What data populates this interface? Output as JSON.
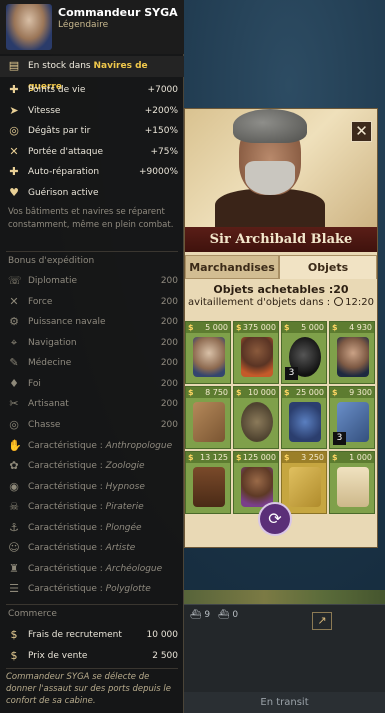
{
  "commander": {
    "name": "Commandeur SYGA",
    "rank": "Légendaire",
    "stock_prefix": "En stock dans ",
    "stock_location": "Navires de guerre"
  },
  "effects": [
    {
      "icon": "plus-icon",
      "label": "Points de vie",
      "value": "+7000"
    },
    {
      "icon": "speed-icon",
      "label": "Vitesse",
      "value": "+200%"
    },
    {
      "icon": "target-icon",
      "label": "Dégâts par tir",
      "value": "+150%"
    },
    {
      "icon": "crossed-swords-icon",
      "label": "Portée d'attaque",
      "value": "+75%"
    },
    {
      "icon": "plus-icon",
      "label": "Auto-réparation",
      "value": "+9000%"
    },
    {
      "icon": "heart-icon",
      "label": "Guérison active",
      "value": ""
    }
  ],
  "effects_description": "Vos bâtiments et navires se réparent constamment, même en plein combat.",
  "expedition": {
    "title": "Bonus d'expédition",
    "items": [
      {
        "icon": "diplomacy-icon",
        "label": "Diplomatie",
        "value": "200"
      },
      {
        "icon": "force-icon",
        "label": "Force",
        "value": "200"
      },
      {
        "icon": "naval-power-icon",
        "label": "Puissance navale",
        "value": "200"
      },
      {
        "icon": "navigation-icon",
        "label": "Navigation",
        "value": "200"
      },
      {
        "icon": "medicine-icon",
        "label": "Médecine",
        "value": "200"
      },
      {
        "icon": "faith-icon",
        "label": "Foi",
        "value": "200"
      },
      {
        "icon": "crafting-icon",
        "label": "Artisanat",
        "value": "200"
      },
      {
        "icon": "hunting-icon",
        "label": "Chasse",
        "value": "200"
      }
    ],
    "traits_prefix": "Caractéristique : ",
    "traits": [
      {
        "icon": "anthropology-icon",
        "label": "Anthropologue"
      },
      {
        "icon": "zoology-icon",
        "label": "Zoologie"
      },
      {
        "icon": "hypnosis-icon",
        "label": "Hypnose"
      },
      {
        "icon": "piracy-icon",
        "label": "Piraterie"
      },
      {
        "icon": "diving-icon",
        "label": "Plongée"
      },
      {
        "icon": "artist-icon",
        "label": "Artiste"
      },
      {
        "icon": "archaeology-icon",
        "label": "Archéologue"
      },
      {
        "icon": "polyglot-icon",
        "label": "Polyglotte"
      }
    ]
  },
  "commerce": {
    "title": "Commerce",
    "items": [
      {
        "icon": "coin-icon",
        "label": "Frais de recrutement",
        "value": "10 000"
      },
      {
        "icon": "coin-icon",
        "label": "Prix de vente",
        "value": "2 500"
      }
    ]
  },
  "flavor_text": "Commandeur SYGA se délecte de donner l'assaut sur des ports depuis le confort de sa cabine.",
  "trader": {
    "name": "Sir Archibald Blake",
    "tabs": [
      "Marchandises",
      "Objets"
    ],
    "active_tab": "Objets",
    "buyable_label": "Objets achetables :20",
    "restock_label": "avitaillement d'objets dans :",
    "restock_time": "12:20",
    "currency_symbol": "$",
    "items": [
      {
        "price": "5 000",
        "art": "officer-portrait-icon",
        "color": "green",
        "qty": ""
      },
      {
        "price": "375 000",
        "art": "woman-portrait-icon",
        "color": "green",
        "qty": ""
      },
      {
        "price": "5 000",
        "art": "cannonball-icon",
        "color": "green",
        "qty": "3"
      },
      {
        "price": "4 930",
        "art": "captain-portrait-icon",
        "color": "green",
        "qty": ""
      },
      {
        "price": "8 750",
        "art": "crate-icon",
        "color": "green",
        "qty": ""
      },
      {
        "price": "10 000",
        "art": "propeller-icon",
        "color": "green",
        "qty": ""
      },
      {
        "price": "25 000",
        "art": "machine-part-icon",
        "color": "green",
        "qty": ""
      },
      {
        "price": "9 300",
        "art": "cargo-box-icon",
        "color": "green",
        "qty": "3"
      },
      {
        "price": "13 125",
        "art": "barrel-icon",
        "color": "green",
        "qty": ""
      },
      {
        "price": "125 000",
        "art": "lady-portrait-icon",
        "color": "green",
        "qty": ""
      },
      {
        "price": "3 250",
        "art": "gold-item-icon",
        "color": "yellow",
        "qty": ""
      },
      {
        "price": "1 000",
        "art": "scroll-icon",
        "color": "green",
        "qty": ""
      }
    ]
  },
  "fleet": {
    "slots": [
      {
        "count": "9"
      },
      {
        "count": "0"
      }
    ],
    "status": "En transit"
  },
  "colors": {
    "tooltip_bg": "#161616",
    "highlight": "#f0c84b",
    "trader_bg": "#e9d9b5",
    "name_bar": "#5a1e17",
    "slot_green": "#7fa04a"
  }
}
